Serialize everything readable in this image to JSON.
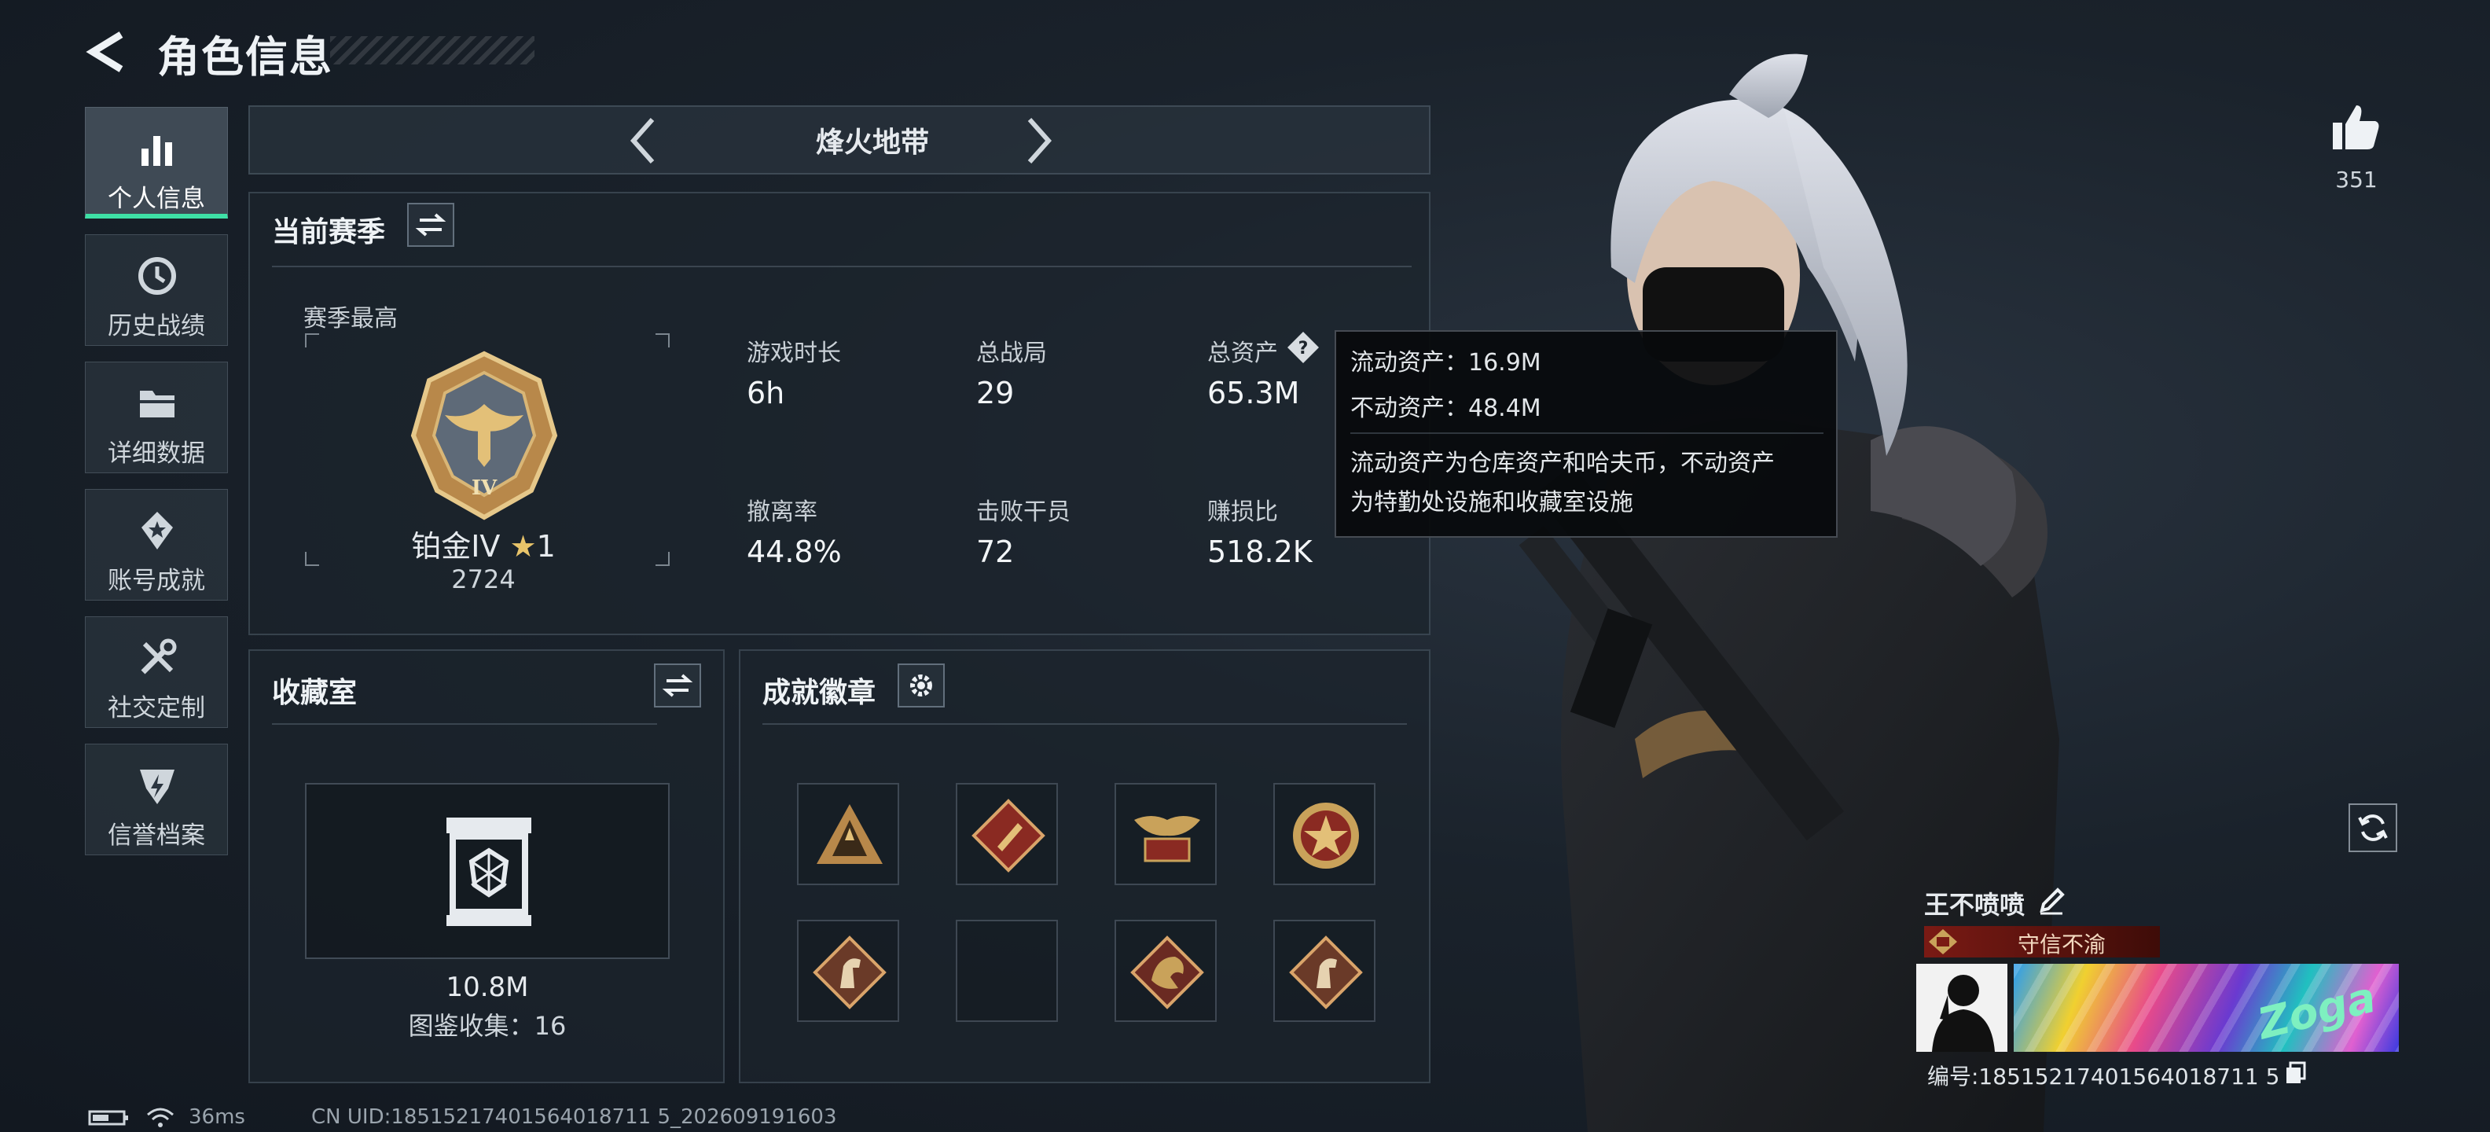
{
  "header": {
    "title": "角色信息"
  },
  "sidebar": {
    "items": [
      {
        "label": "个人信息"
      },
      {
        "label": "历史战绩"
      },
      {
        "label": "详细数据"
      },
      {
        "label": "账号成就"
      },
      {
        "label": "社交定制"
      },
      {
        "label": "信誉档案"
      }
    ]
  },
  "mode_selector": {
    "title": "烽火地带"
  },
  "season": {
    "title": "当前赛季",
    "best_label": "赛季最高",
    "rank_name": "铂金IV",
    "rank_stars": "1",
    "rank_score": "2724",
    "rank_emblem_numeral": "IV",
    "stats": [
      {
        "label": "游戏时长",
        "value": "6h"
      },
      {
        "label": "总战局",
        "value": "29"
      },
      {
        "label": "总资产",
        "value": "65.3M"
      },
      {
        "label": "撤离率",
        "value": "44.8%"
      },
      {
        "label": "击败干员",
        "value": "72"
      },
      {
        "label": "赚损比",
        "value": "518.2K"
      }
    ]
  },
  "tooltip": {
    "line1": "流动资产：16.9M",
    "line2": "不动资产：48.4M",
    "desc_line1": "流动资产为仓库资产和哈夫币，不动资产",
    "desc_line2": "为特勤处设施和收藏室设施"
  },
  "collection": {
    "title": "收藏室",
    "value": "10.8M",
    "catalog_text": "图鉴收集：16"
  },
  "achievements": {
    "title": "成就徽章",
    "badges": [
      "badge-triangle-icon",
      "badge-diamond-red-icon",
      "badge-eagle-icon",
      "badge-star-medal-icon",
      "badge-horse-icon",
      "badge-empty",
      "badge-dragon-icon",
      "badge-horse-icon"
    ]
  },
  "likes": {
    "count": "351"
  },
  "player": {
    "name": "王不喷喷",
    "title_badge": "守信不渝",
    "id_text": "编号:18515217401564018711 5",
    "banner_text": "Zoga"
  },
  "status_bar": {
    "ping": "36ms",
    "uid": "CN UID:18515217401564018711 5_202609191603"
  },
  "colors": {
    "accent": "#3ee0a6",
    "gold": "#c9a25a",
    "title_red": "#7a1a14"
  }
}
